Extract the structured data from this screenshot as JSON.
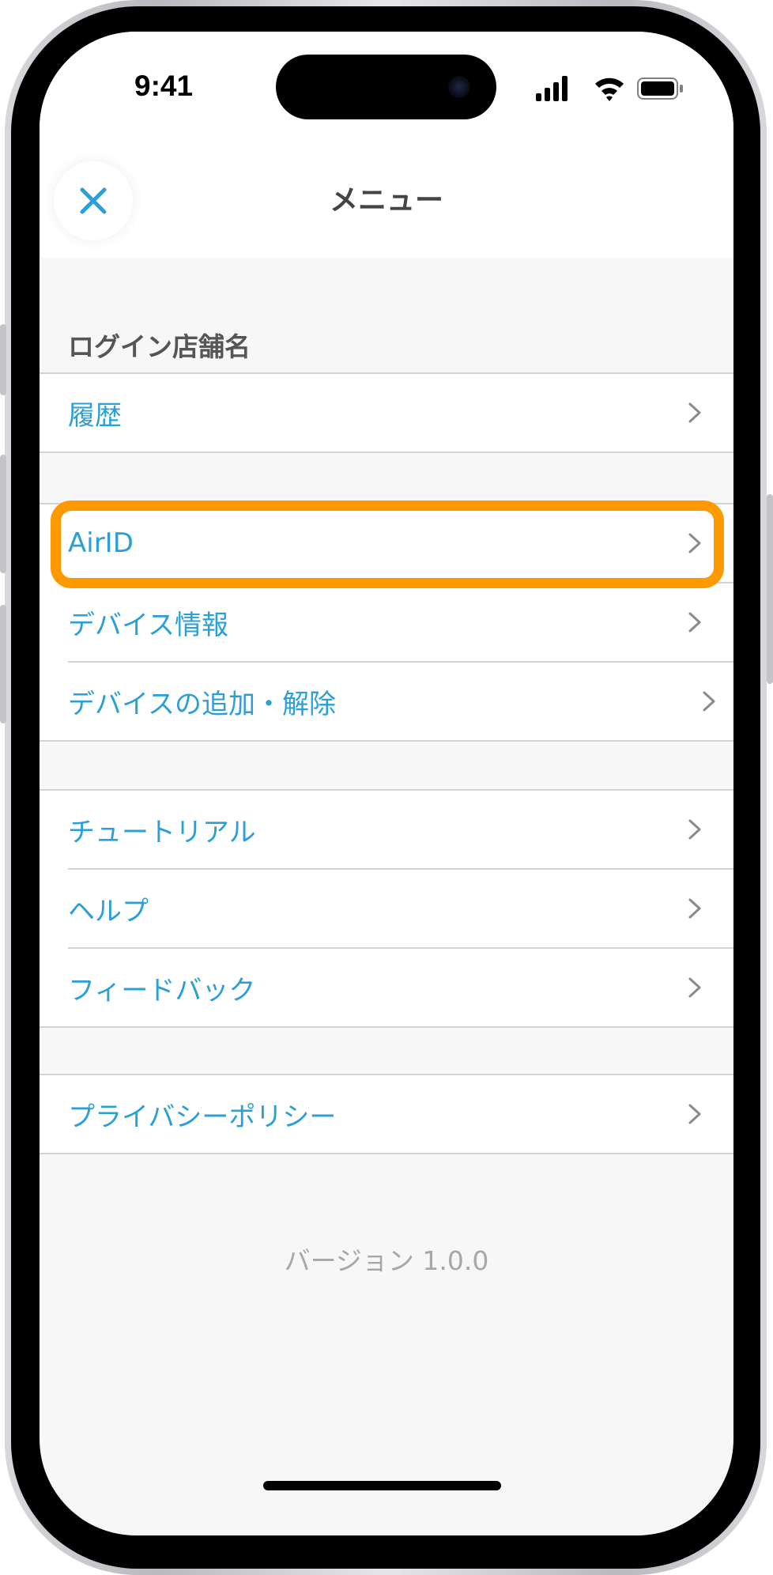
{
  "status_bar": {
    "time": "9:41"
  },
  "header": {
    "title": "メニュー",
    "close_icon": "close-icon"
  },
  "section": {
    "label": "ログイン店舗名"
  },
  "groups": [
    {
      "items": [
        {
          "label": "履歴"
        }
      ]
    },
    {
      "items": [
        {
          "label": "AirID"
        },
        {
          "label": "デバイス情報"
        },
        {
          "label": "デバイスの追加・解除"
        }
      ]
    },
    {
      "items": [
        {
          "label": "チュートリアル"
        },
        {
          "label": "ヘルプ"
        },
        {
          "label": "フィードバック"
        }
      ]
    },
    {
      "items": [
        {
          "label": "プライバシーポリシー"
        }
      ]
    }
  ],
  "version": {
    "text": "バージョン 1.0.0"
  },
  "colors": {
    "accent": "#2b9fd6",
    "highlight": "#ff9900",
    "title": "#444444"
  }
}
